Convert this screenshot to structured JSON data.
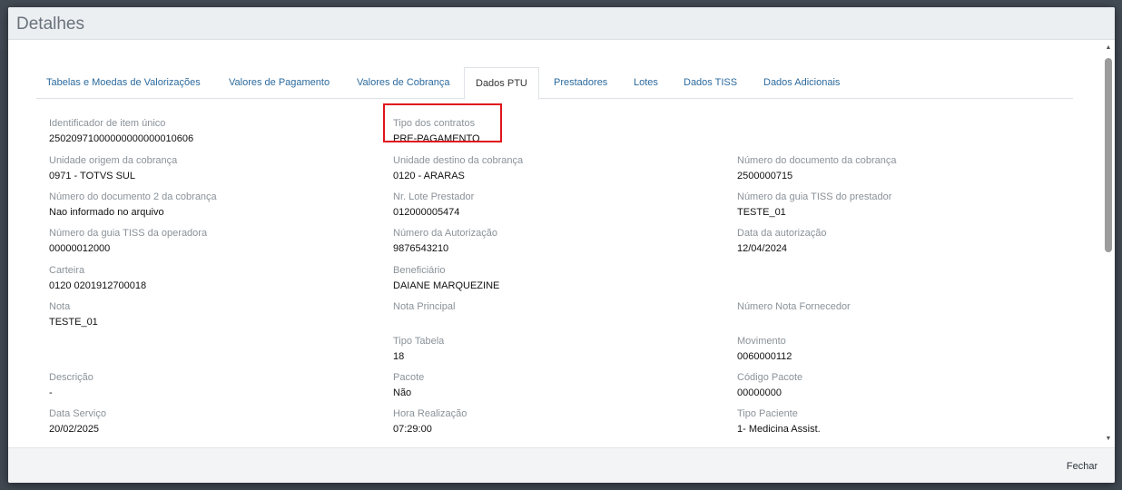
{
  "modal": {
    "title": "Detalhes",
    "close_label": "Fechar"
  },
  "tabs": [
    {
      "label": "Tabelas e Moedas de Valorizações",
      "active": false
    },
    {
      "label": "Valores de Pagamento",
      "active": false
    },
    {
      "label": "Valores de Cobrança",
      "active": false
    },
    {
      "label": "Dados PTU",
      "active": true
    },
    {
      "label": "Prestadores",
      "active": false
    },
    {
      "label": "Lotes",
      "active": false
    },
    {
      "label": "Dados TISS",
      "active": false
    },
    {
      "label": "Dados Adicionais",
      "active": false
    }
  ],
  "fields": {
    "identificador": {
      "label": "Identificador de item único",
      "value": "25020971000000000000010606"
    },
    "tipo_contratos": {
      "label": "Tipo dos contratos",
      "value": "PRE-PAGAMENTO"
    },
    "unidade_origem": {
      "label": "Unidade origem da cobrança",
      "value": "0971 - TOTVS SUL"
    },
    "unidade_destino": {
      "label": "Unidade destino da cobrança",
      "value": "0120 - ARARAS"
    },
    "num_doc_cobranca": {
      "label": "Número do documento da cobrança",
      "value": "2500000715"
    },
    "num_doc2_cobranca": {
      "label": "Número do documento 2 da cobrança",
      "value": "Nao informado no arquivo"
    },
    "lote_prestador": {
      "label": "Nr. Lote Prestador",
      "value": "012000005474"
    },
    "guia_tiss_prestador": {
      "label": "Número da guia TISS do prestador",
      "value": "TESTE_01"
    },
    "guia_tiss_operadora": {
      "label": "Número da guia TISS da operadora",
      "value": "00000012000"
    },
    "num_autorizacao": {
      "label": "Número da Autorização",
      "value": "9876543210"
    },
    "data_autorizacao": {
      "label": "Data da autorização",
      "value": "12/04/2024"
    },
    "carteira": {
      "label": "Carteira",
      "value": "0120 0201912700018"
    },
    "beneficiario": {
      "label": "Beneficiário",
      "value": "DAIANE MARQUEZINE"
    },
    "nota": {
      "label": "Nota",
      "value": "TESTE_01"
    },
    "nota_principal": {
      "label": "Nota Principal",
      "value": ""
    },
    "num_nota_fornecedor": {
      "label": "Número Nota Fornecedor",
      "value": ""
    },
    "tipo_tabela": {
      "label": "Tipo Tabela",
      "value": "18"
    },
    "movimento": {
      "label": "Movimento",
      "value": "0060000112"
    },
    "descricao": {
      "label": "Descrição",
      "value": "-"
    },
    "pacote": {
      "label": "Pacote",
      "value": "Não"
    },
    "codigo_pacote": {
      "label": "Código Pacote",
      "value": "00000000"
    },
    "data_servico": {
      "label": "Data Serviço",
      "value": "20/02/2025"
    },
    "hora_realizacao": {
      "label": "Hora Realização",
      "value": "07:29:00"
    },
    "tipo_paciente": {
      "label": "Tipo Paciente",
      "value": "1- Medicina Assist."
    }
  }
}
